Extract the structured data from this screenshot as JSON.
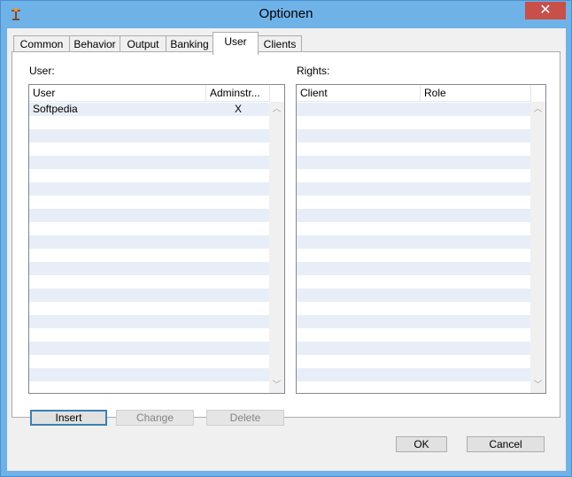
{
  "window": {
    "title": "Optionen"
  },
  "tabs": [
    {
      "label": "Common"
    },
    {
      "label": "Behavior"
    },
    {
      "label": "Output"
    },
    {
      "label": "Banking"
    },
    {
      "label": "User"
    },
    {
      "label": "Clients"
    }
  ],
  "active_tab": "User",
  "user_section": {
    "label": "User:",
    "columns": [
      "User",
      "Adminstr..."
    ],
    "rows": [
      {
        "user": "Softpedia",
        "admin": "X"
      }
    ]
  },
  "rights_section": {
    "label": "Rights:",
    "columns": [
      "Client",
      "Role"
    ],
    "rows": []
  },
  "buttons": {
    "insert": "Insert",
    "change": "Change",
    "delete": "Delete",
    "ok": "OK",
    "cancel": "Cancel"
  },
  "colors": {
    "row_alt": "#e8eef8",
    "close": "#c7504b",
    "frame": "#6fb2e8"
  }
}
